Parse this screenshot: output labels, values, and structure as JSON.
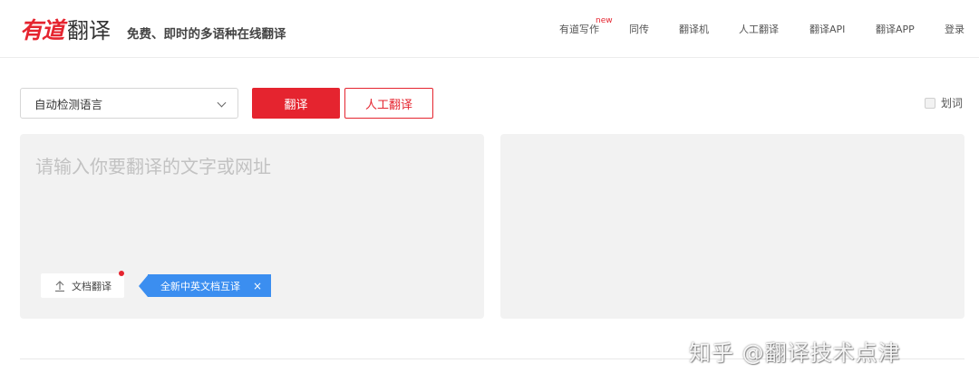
{
  "header": {
    "logo_brand": "有道",
    "logo_product": "翻译",
    "slogan": "免费、即时的多语种在线翻译",
    "nav": [
      {
        "label": "有道写作",
        "badge": "new"
      },
      {
        "label": "同传"
      },
      {
        "label": "翻译机"
      },
      {
        "label": "人工翻译"
      },
      {
        "label": "翻译API"
      },
      {
        "label": "翻译APP"
      },
      {
        "label": "登录"
      }
    ]
  },
  "toolbar": {
    "language_select": "自动检测语言",
    "translate_button": "翻译",
    "human_translate_button": "人工翻译",
    "word_select_label": "划词"
  },
  "input": {
    "placeholder": "请输入你要翻译的文字或网址",
    "doc_translate_label": "文档翻译",
    "tip_text": "全新中英文档互译",
    "tip_close": "×"
  },
  "watermark": "知乎 @翻译技术点津",
  "colors": {
    "brand_red": "#e5242f",
    "tip_blue": "#3b8ef0",
    "panel_bg": "#f2f2f2"
  }
}
